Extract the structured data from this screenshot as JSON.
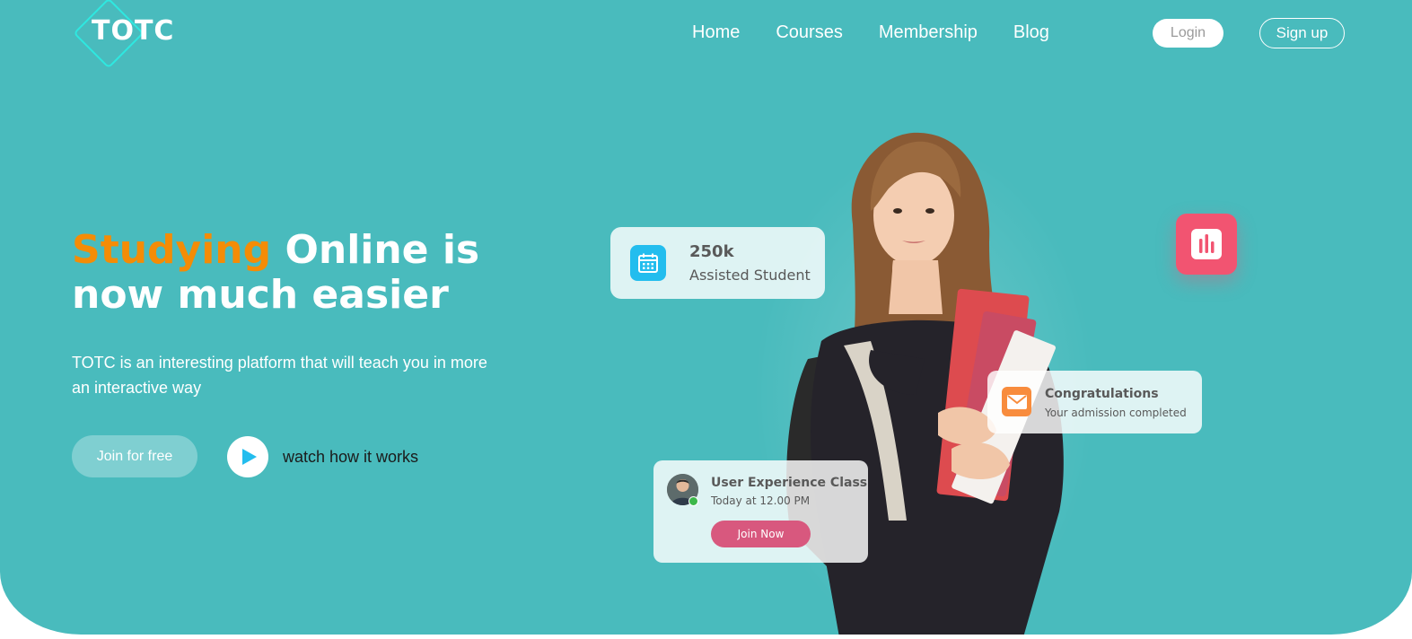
{
  "brand": {
    "name": "TOTC"
  },
  "nav": {
    "items": [
      {
        "label": "Home"
      },
      {
        "label": "Courses"
      },
      {
        "label": "Membership"
      },
      {
        "label": "Blog"
      }
    ],
    "login_label": "Login",
    "signup_label": "Sign up"
  },
  "hero": {
    "headline_accent": "Studying",
    "headline_rest_1": " Online is",
    "headline_rest_2": "now much easier",
    "subtext": "TOTC is an interesting platform that will teach you in more an interactive way",
    "join_free_label": "Join for free",
    "watch_label": "watch how it works"
  },
  "cards": {
    "students": {
      "value": "250k",
      "label": "Assisted Student",
      "icon": "calendar-icon"
    },
    "analytics": {
      "icon": "bar-chart-icon"
    },
    "congrats": {
      "title": "Congratulations",
      "subtitle": "Your admission completed",
      "icon": "mail-icon"
    },
    "class": {
      "title": "User Experience Class",
      "time": "Today at 12.00 PM",
      "join_label": "Join Now"
    }
  },
  "colors": {
    "background": "#49BBBD",
    "accent_orange": "#F48C06",
    "calendar_blue": "#23BDEE",
    "chart_pink": "#F25471",
    "mail_orange": "#F88C3D",
    "join_now_pink": "#D8587E",
    "online_green": "#3CB84A"
  }
}
